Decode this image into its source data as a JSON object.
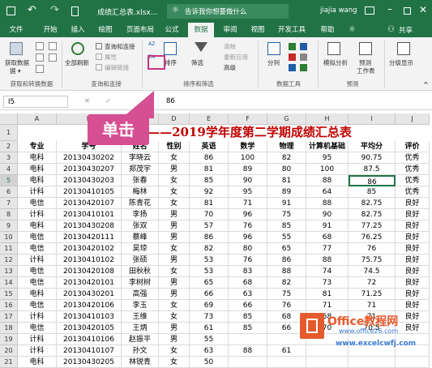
{
  "titlebar": {
    "undo_glyph": "↶",
    "redo_glyph": "↷",
    "filename": "成绩汇总表.xlsx...",
    "search_placeholder": "告诉我你想要做什么",
    "user": "jiajia wang"
  },
  "tabs": [
    {
      "label": "文件"
    },
    {
      "label": "开始"
    },
    {
      "label": "插入"
    },
    {
      "label": "绘图"
    },
    {
      "label": "页面布局"
    },
    {
      "label": "公式"
    },
    {
      "label": "数据",
      "active": true
    },
    {
      "label": "审阅"
    },
    {
      "label": "视图"
    },
    {
      "label": "开发工具"
    },
    {
      "label": "帮助"
    }
  ],
  "share_label": "共享",
  "ribbon": {
    "get_data": "获取数据",
    "get_data_sub": "据 ▾",
    "refresh_all": "全部刷新",
    "queries_connections": "查询和连接",
    "properties": "属性",
    "edit_links": "编辑链接",
    "sort": "排序",
    "filter": "筛选",
    "clear": "清除",
    "reapply": "重新应用",
    "advanced": "高级",
    "split": "分列",
    "whatif": "模拟分析",
    "forecast": "预测",
    "forecast_sheet": "工作表",
    "outline": "分级显示",
    "group_get_transform": "获取和转换数据",
    "group_queries": "查询和连接",
    "group_sort_filter": "排序和筛选",
    "group_data_tools": "数据工具",
    "group_forecast": "预测"
  },
  "formula_bar": {
    "name_box": "I5",
    "fx": "fx",
    "value": "86"
  },
  "columns": [
    "A",
    "B",
    "C",
    "D",
    "E",
    "F",
    "G",
    "H",
    "I",
    "J"
  ],
  "sheet_title": "理工学院——2019学年度第二学期成绩汇总表",
  "headers": [
    "专业",
    "学号",
    "姓名",
    "性别",
    "英语",
    "数学",
    "物理",
    "计算机基础",
    "平均分",
    "评价"
  ],
  "rows": [
    [
      "电科",
      "20130430202",
      "李晓云",
      "女",
      "86",
      "100",
      "82",
      "95",
      "90.75",
      "优秀"
    ],
    [
      "电科",
      "20130430207",
      "郑茂宇",
      "男",
      "81",
      "89",
      "80",
      "100",
      "87.5",
      "优秀"
    ],
    [
      "电科",
      "20130430203",
      "张春",
      "女",
      "85",
      "90",
      "81",
      "88",
      "86",
      "优秀"
    ],
    [
      "计科",
      "20130410105",
      "梅林",
      "女",
      "92",
      "95",
      "89",
      "64",
      "85",
      "优秀"
    ],
    [
      "电信",
      "20130420107",
      "陈青花",
      "女",
      "81",
      "71",
      "91",
      "88",
      "82.75",
      "良好"
    ],
    [
      "计科",
      "20130410101",
      "李扬",
      "男",
      "70",
      "96",
      "75",
      "90",
      "82.75",
      "良好"
    ],
    [
      "电科",
      "20130430208",
      "张双",
      "男",
      "57",
      "76",
      "85",
      "91",
      "77.25",
      "良好"
    ],
    [
      "电信",
      "20130420111",
      "蔡峰",
      "男",
      "86",
      "96",
      "55",
      "68",
      "76.25",
      "良好"
    ],
    [
      "电信",
      "20130420102",
      "吴琼",
      "女",
      "82",
      "80",
      "65",
      "77",
      "76",
      "良好"
    ],
    [
      "计科",
      "20130410102",
      "张硕",
      "男",
      "53",
      "76",
      "86",
      "88",
      "75.75",
      "良好"
    ],
    [
      "电信",
      "20130420108",
      "田秋秋",
      "女",
      "53",
      "83",
      "88",
      "74",
      "74.5",
      "良好"
    ],
    [
      "电信",
      "20130420101",
      "李树树",
      "男",
      "65",
      "68",
      "82",
      "73",
      "72",
      "良好"
    ],
    [
      "电科",
      "20130430201",
      "高强",
      "男",
      "66",
      "63",
      "75",
      "81",
      "71.25",
      "良好"
    ],
    [
      "电信",
      "20130420106",
      "李玉",
      "女",
      "69",
      "66",
      "76",
      "71",
      "71",
      "良好"
    ],
    [
      "计科",
      "20130410103",
      "王维",
      "女",
      "73",
      "85",
      "68",
      "58",
      "71",
      "良好"
    ],
    [
      "电信",
      "20130420105",
      "王炳",
      "男",
      "61",
      "85",
      "66",
      "70",
      "70.5",
      "良好"
    ],
    [
      "计科",
      "20130410106",
      "赵振平",
      "男",
      "55",
      "",
      "",
      "",
      "",
      ""
    ],
    [
      "计科",
      "20130410107",
      "孙文",
      "女",
      "63",
      "88",
      "61",
      "",
      "",
      ""
    ],
    [
      "电科",
      "20130430205",
      "林锐青",
      "女",
      "50",
      "",
      "",
      "",
      "",
      ""
    ]
  ],
  "callout_label": "单击",
  "watermark_line1": "Office教程网",
  "watermark_line2": "www.office26.com",
  "watermark_line3": "www.excelcwfj.com"
}
